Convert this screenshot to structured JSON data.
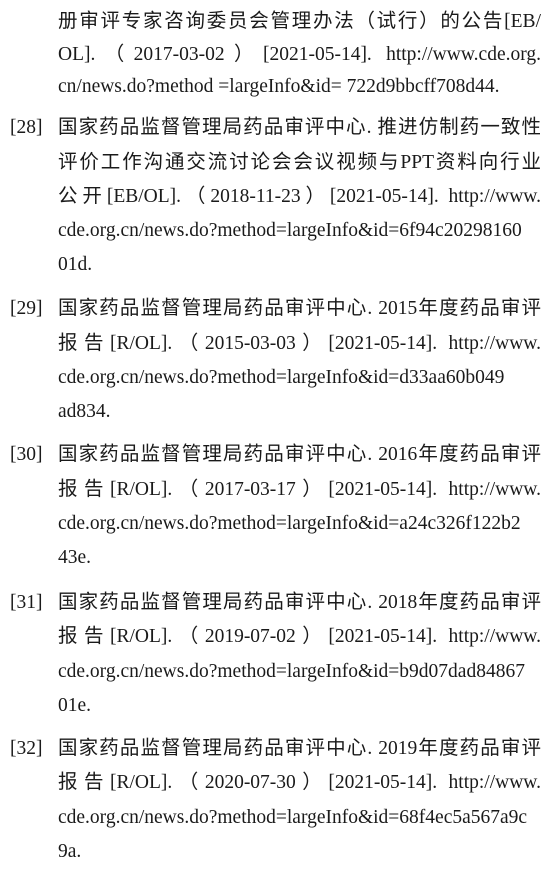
{
  "references": [
    {
      "number": "",
      "lines": [
        "册审评专家咨询委员会管理办法（试行）的公告[EB/",
        "OL].（2017-03-02）[2021-05-14]. http://www.cde.org.",
        "cn/news.do?method =largeInfo&id= 722d9bbcff708d44."
      ]
    },
    {
      "number": "[28]",
      "lines": [
        "国家药品监督管理局药品审评中心. 推进仿制药一致性",
        "评价工作沟通交流讨论会会议视频与PPT资料向行业",
        "公开[EB/OL].（2018-11-23）[2021-05-14]. http://www.",
        "cde.org.cn/news.do?method=largeInfo&id=6f94c20298160",
        "01d."
      ]
    },
    {
      "number": "[29]",
      "lines": [
        "国家药品监督管理局药品审评中心. 2015年度药品审评",
        "报告[R/OL].（2015-03-03）[2021-05-14]. http://www.",
        "cde.org.cn/news.do?method=largeInfo&id=d33aa60b049",
        "ad834."
      ]
    },
    {
      "number": "[30]",
      "lines": [
        "国家药品监督管理局药品审评中心. 2016年度药品审评",
        "报告[R/OL].（2017-03-17）[2021-05-14]. http://www.",
        "cde.org.cn/news.do?method=largeInfo&id=a24c326f122b2",
        "43e."
      ]
    },
    {
      "number": "[31]",
      "lines": [
        "国家药品监督管理局药品审评中心. 2018年度药品审评",
        "报告[R/OL].（2019-07-02）[2021-05-14]. http://www.",
        "cde.org.cn/news.do?method=largeInfo&id=b9d07dad84867",
        "01e."
      ]
    },
    {
      "number": "[32]",
      "lines": [
        "国家药品监督管理局药品审评中心. 2019年度药品审评",
        "报告[R/OL].（2020-07-30）[2021-05-14]. http://www.",
        "cde.org.cn/news.do?method=largeInfo&id=68f4ec5a567a9c",
        "9a."
      ]
    }
  ]
}
